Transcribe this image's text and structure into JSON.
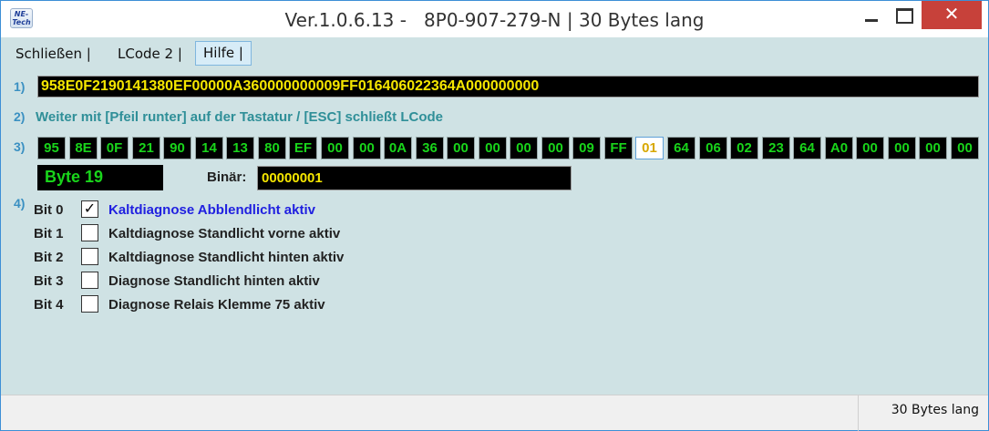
{
  "window": {
    "title": "Ver.1.0.6.13 -   8P0-907-279-N | 30 Bytes lang",
    "logo_text": "NE-Tech",
    "close_glyph": "✕"
  },
  "menu": {
    "items": [
      "Schließen |",
      "LCode 2 |",
      "Hilfe |"
    ]
  },
  "row1": {
    "label": "1)",
    "hex": "958E0F2190141380EF00000A360000000009FF016406022364A000000000"
  },
  "row2": {
    "label": "2)",
    "info": "Weiter mit [Pfeil runter] auf der Tastatur / [ESC] schließt LCode"
  },
  "row3": {
    "label": "3)",
    "bytes": [
      "95",
      "8E",
      "0F",
      "21",
      "90",
      "14",
      "13",
      "80",
      "EF",
      "00",
      "00",
      "0A",
      "36",
      "00",
      "00",
      "00",
      "00",
      "09",
      "FF",
      "01",
      "64",
      "06",
      "02",
      "23",
      "64",
      "A0",
      "00",
      "00",
      "00",
      "00"
    ],
    "selected_index": 19,
    "byte_label": "Byte 19",
    "binar_label": "Binär:",
    "binar_value": "00000001"
  },
  "row4": {
    "label": "4)",
    "bits": [
      {
        "name": "Bit 0",
        "checked": true,
        "check_glyph": "✓",
        "desc": "Kaltdiagnose Abblendlicht aktiv"
      },
      {
        "name": "Bit 1",
        "checked": false,
        "check_glyph": "",
        "desc": "Kaltdiagnose Standlicht vorne aktiv"
      },
      {
        "name": "Bit 2",
        "checked": false,
        "check_glyph": "",
        "desc": "Kaltdiagnose Standlicht hinten aktiv"
      },
      {
        "name": "Bit 3",
        "checked": false,
        "check_glyph": "",
        "desc": "Diagnose Standlicht hinten aktiv"
      },
      {
        "name": "Bit 4",
        "checked": false,
        "check_glyph": "",
        "desc": "Diagnose Relais Klemme 75 aktiv"
      }
    ]
  },
  "status": {
    "text": "30 Bytes lang"
  },
  "colors": {
    "hex_text": "#f5e600",
    "byte_text": "#19d51b",
    "active_bit": "#2020e0",
    "label_blue": "#3a90c2",
    "info_teal": "#2f8f98",
    "window_bg": "#cfe2e4",
    "close_red": "#c7413a"
  }
}
